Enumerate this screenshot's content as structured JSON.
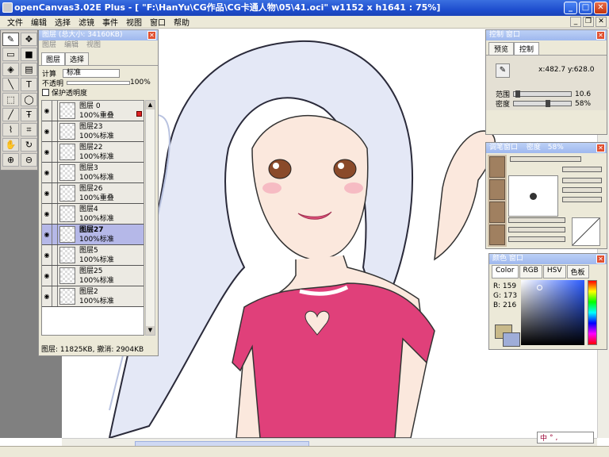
{
  "window": {
    "title": "openCanvas3.02E Plus - [ \"F:\\HanYu\\CG作品\\CG卡通人物\\05\\41.oci\" w1152 x h1641 : 75%]"
  },
  "menu": [
    "文件",
    "编辑",
    "选择",
    "滤镜",
    "事件",
    "视图",
    "窗口",
    "帮助"
  ],
  "layers_panel": {
    "title": "图层 (总大小: 34160KB)",
    "menu": [
      "图层",
      "编辑",
      "视图"
    ],
    "tabs": [
      "图层",
      "选择"
    ],
    "calc_label": "计算",
    "blend_mode": "标准",
    "opacity_label": "不透明",
    "opacity_value": "100%",
    "protect_label": "保护透明度",
    "layers": [
      {
        "name": "图层 0",
        "info": "100%重叠",
        "flag": true
      },
      {
        "name": "图层23",
        "info": "100%标准"
      },
      {
        "name": "图层22",
        "info": "100%标准"
      },
      {
        "name": "图层3",
        "info": "100%标准"
      },
      {
        "name": "图层26",
        "info": "100%重叠"
      },
      {
        "name": "图层4",
        "info": "100%标准"
      },
      {
        "name": "图层27",
        "info": "100%标准",
        "selected": true
      },
      {
        "name": "图层5",
        "info": "100%标准"
      },
      {
        "name": "图层25",
        "info": "100%标准"
      },
      {
        "name": "图层2",
        "info": "100%标准"
      }
    ],
    "status": "图层: 11825KB, 撤消: 2904KB"
  },
  "control_panel": {
    "title": "控制 窗口",
    "tabs": [
      "预览",
      "控制"
    ],
    "coords": "x:482.7 y:628.0",
    "range_label": "范围",
    "range_value": "10.6",
    "density_label": "密度",
    "density_value": "58%"
  },
  "brush_panel": {
    "title": "调笔窗口",
    "density_label": "密度",
    "density_value": "58%"
  },
  "color_panel": {
    "title": "颜色 窗口",
    "tabs": [
      "Color",
      "RGB",
      "HSV",
      "色板"
    ],
    "r": "R: 159",
    "g": "G: 173",
    "b": "B: 216",
    "fg": "#9fadd8",
    "bg": "#c8b98a"
  }
}
